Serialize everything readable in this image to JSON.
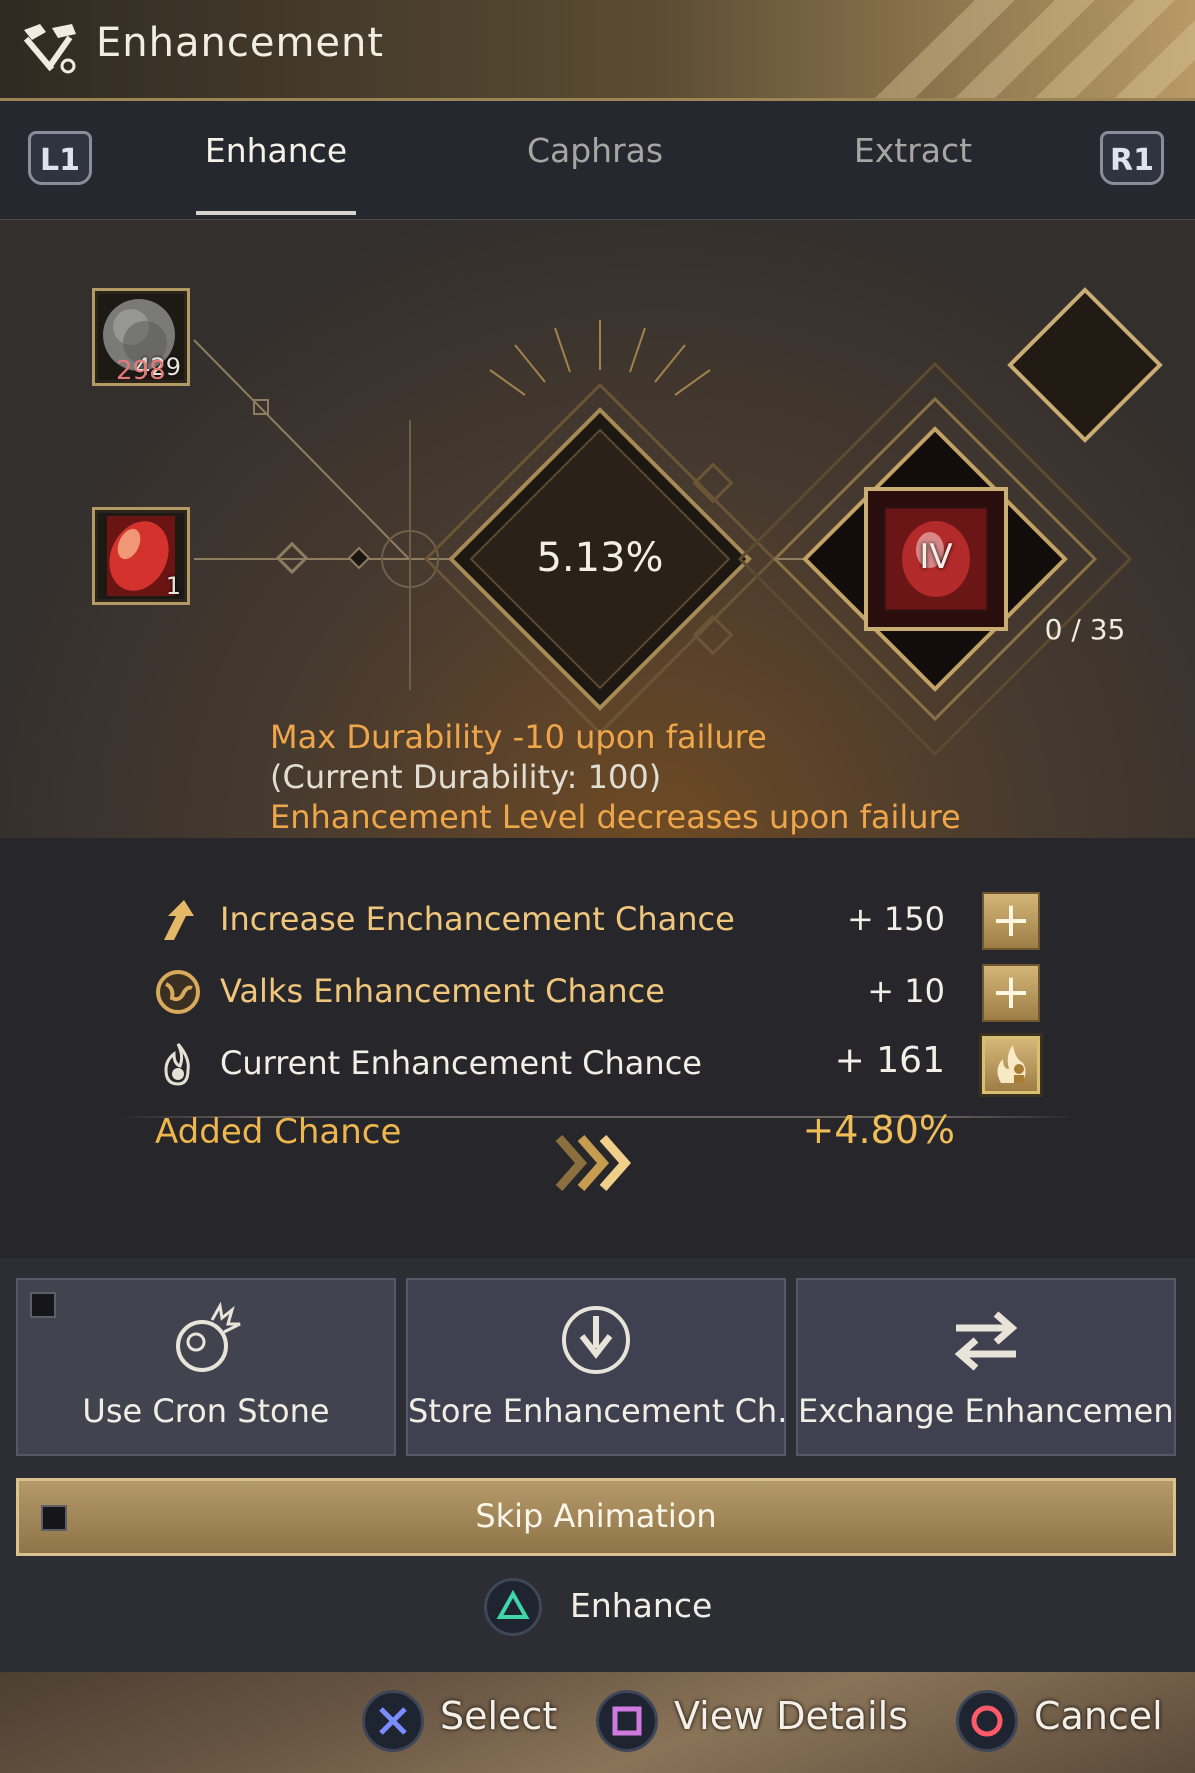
{
  "window": {
    "title": "Enhancement"
  },
  "tabs": {
    "left_shoulder": "L1",
    "right_shoulder": "R1",
    "items": [
      {
        "label": "Enhance",
        "active": true
      },
      {
        "label": "Caphras",
        "active": false
      },
      {
        "label": "Extract",
        "active": false
      }
    ]
  },
  "materials": {
    "stone": {
      "icon": "black-stone-icon",
      "count": "429",
      "required": "298"
    },
    "gem": {
      "icon": "ruby-gem-icon",
      "count": "1"
    }
  },
  "enhance": {
    "success_chance": "5.13%",
    "item_level": "IV",
    "fail_stacks": "0 / 35"
  },
  "warnings": {
    "durability": "Max Durability -10 upon failure",
    "current_durability": "(Current Durability: 100)",
    "level_decrease": "Enhancement Level decreases upon failure"
  },
  "stats": [
    {
      "icon": "arrow-up-icon",
      "label": "Increase Enchancement Chance",
      "value": "+ 150",
      "button_icon": "plus-icon"
    },
    {
      "icon": "globe-icon",
      "label": "Valks Enhancement Chance",
      "value": "+ 10",
      "button_icon": "plus-icon"
    },
    {
      "icon": "flame-icon",
      "label": "Current Enhancement Chance",
      "value": "+ 161",
      "button_icon": "fire-people-icon"
    }
  ],
  "added_chance": {
    "label": "Added Chance",
    "value": "+4.80%"
  },
  "options": [
    {
      "label": "Use Cron Stone",
      "icon": "cron-stone-icon",
      "checkbox": true
    },
    {
      "label": "Store Enhancement Ch...",
      "icon": "download-circle-icon"
    },
    {
      "label": "Exchange Enhancemen...",
      "icon": "swap-arrows-icon"
    }
  ],
  "skip_animation": {
    "label": "Skip Animation",
    "checked": false
  },
  "primary_action": {
    "label": "Enhance",
    "button": "triangle"
  },
  "footer": [
    {
      "label": "Select",
      "button": "cross",
      "color": "#7a8cff"
    },
    {
      "label": "View Details",
      "button": "square",
      "color": "#d07adf"
    },
    {
      "label": "Cancel",
      "button": "circle",
      "color": "#ff5a6a"
    }
  ],
  "colors": {
    "gold": "#efc67c",
    "warning_orange": "#eea64a",
    "added_chance": "#f0be58",
    "stone_required": "#e57a7a"
  }
}
